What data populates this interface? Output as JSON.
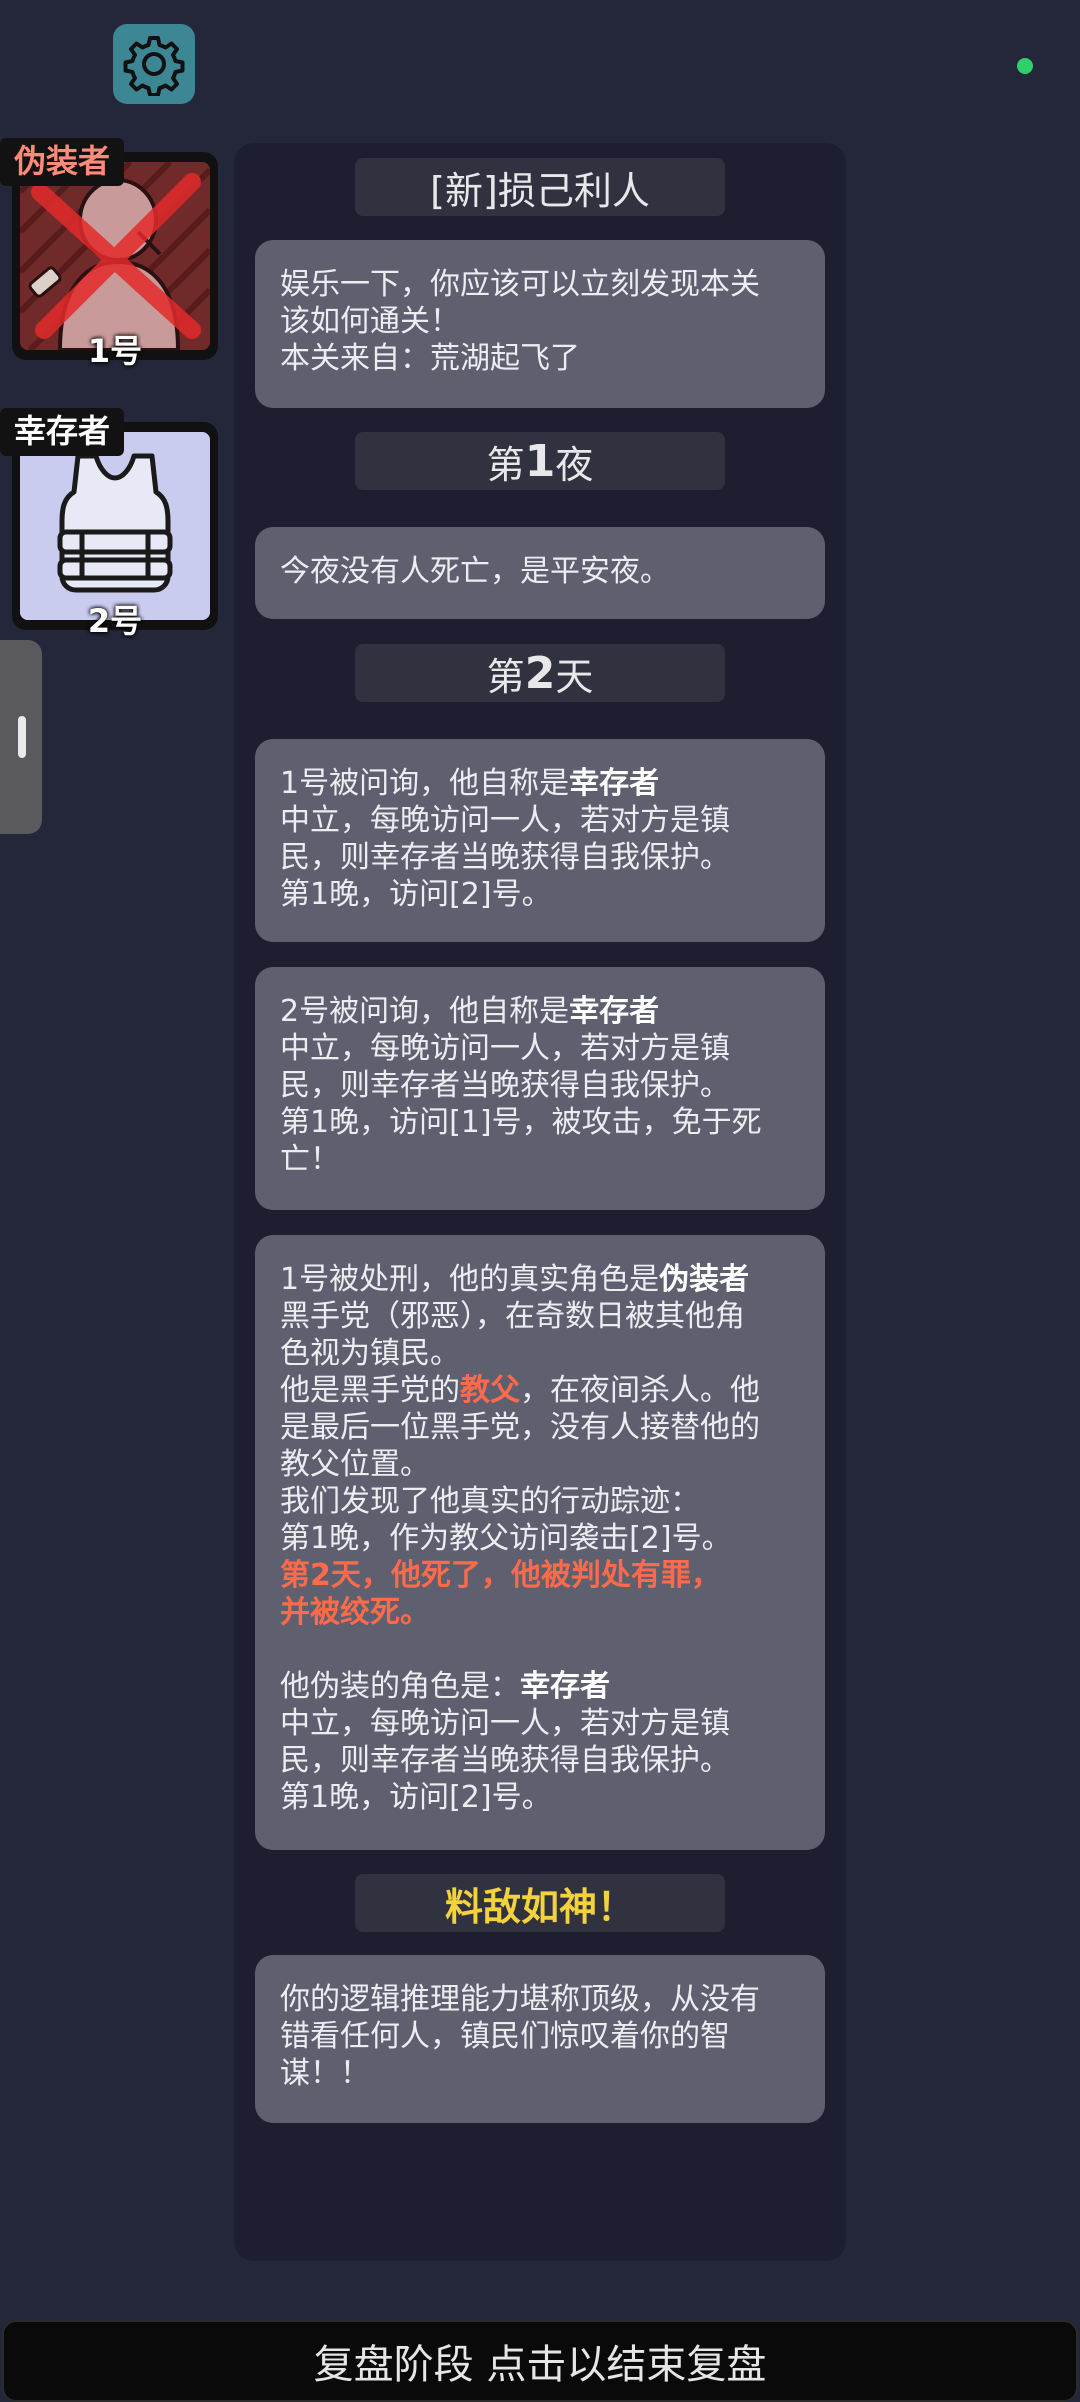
{
  "players": [
    {
      "role": "伪装者",
      "number": "1号",
      "role_color": "#ff8a7a",
      "eliminated": true
    },
    {
      "role": "幸存者",
      "number": "2号",
      "role_color": "#ffffff",
      "eliminated": false
    }
  ],
  "log": {
    "level_title": "[新]损己利人",
    "intro": {
      "line1": "娱乐一下，你应该可以立刻发现本关",
      "line2": "该如何通关！",
      "line3": "本关来自：荒湖起飞了"
    },
    "night1": {
      "prefix": "第",
      "number": "1",
      "suffix": "夜"
    },
    "night1_msg": "今夜没有人死亡，是平安夜。",
    "day2": {
      "prefix": "第",
      "number": "2",
      "suffix": "天"
    },
    "q1": {
      "lead": "1号被问询，他自称是",
      "claim": "幸存者",
      "l1": "中立，每晚访问一人，若对方是镇",
      "l2": "民，则幸存者当晚获得自我保护。",
      "l3": "第1晚，访问[2]号。"
    },
    "q2": {
      "lead": "2号被问询，他自称是",
      "claim": "幸存者",
      "l1": "中立，每晚访问一人，若对方是镇",
      "l2": "民，则幸存者当晚获得自我保护。",
      "l3": "第1晚，访问[1]号，被攻击，免于死",
      "l4": "亡！"
    },
    "exec": {
      "lead": "1号被处刑，他的真实角色是",
      "true_role": "伪装者",
      "l1": "黑手党（邪恶），在奇数日被其他角",
      "l2": "色视为镇民。",
      "l3a": "他是黑手党的",
      "l3_role": "教父",
      "l3b": "，在夜间杀人。他",
      "l4": "是最后一位黑手党，没有人接替他的",
      "l5": "教父位置。",
      "l6": "我们发现了他真实的行动踪迹：",
      "l7": "第1晚，作为教父访问袭击[2]号。",
      "l8": "第2天，他死了，他被判处有罪，",
      "l9": "并被绞死。",
      "disguise_lead": "他伪装的角色是：",
      "disguise_role": "幸存者",
      "d1": "中立，每晚访问一人，若对方是镇",
      "d2": "民，则幸存者当晚获得自我保护。",
      "d3": "第1晚，访问[2]号。"
    },
    "result_title": "料敌如神！",
    "result_title_color": "#f3d23c",
    "result": {
      "l1": "你的逻辑推理能力堪称顶级，从没有",
      "l2": "错看任何人，镇民们惊叹着你的智",
      "l3": "谋！！"
    }
  },
  "bottom_bar": {
    "label": "复盘阶段 点击以结束复盘"
  },
  "colors": {
    "background": "#24263a",
    "panel": "#1d1f30",
    "bubble": "#5e6070",
    "highlight_red": "#ff6a4a",
    "status_dot": "#2fd06a",
    "settings_button": "#3d8795"
  },
  "icons": {
    "settings": "gear-icon",
    "player1": "disguiser-portrait",
    "player2": "bulletproof-vest-icon",
    "eliminated": "red-x-mark"
  }
}
